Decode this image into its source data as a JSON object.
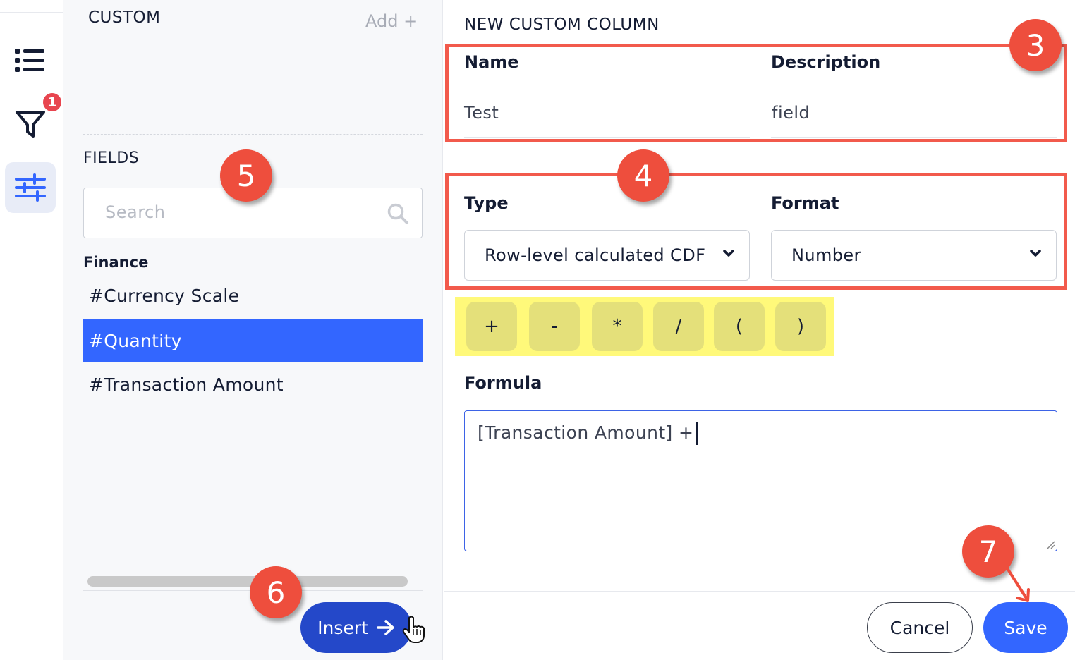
{
  "rail": {
    "items": [
      {
        "name": "list-icon"
      },
      {
        "name": "filter-icon",
        "badge": "1"
      },
      {
        "name": "sliders-icon",
        "active": true
      }
    ]
  },
  "custom": {
    "title": "CUSTOM",
    "add_label": "Add +"
  },
  "fields": {
    "title": "FIELDS",
    "search_placeholder": "Search",
    "group_title": "Finance",
    "items": [
      {
        "label": "#Currency Scale",
        "selected": false
      },
      {
        "label": "#Quantity",
        "selected": true
      },
      {
        "label": "#Transaction Amount",
        "selected": false
      }
    ],
    "insert_label": "Insert"
  },
  "form": {
    "title": "NEW CUSTOM COLUMN",
    "name_label": "Name",
    "name_value": "Test",
    "description_label": "Description",
    "description_value": "field",
    "type_label": "Type",
    "type_value": "Row-level calculated CDF",
    "format_label": "Format",
    "format_value": "Number",
    "operators": [
      "+",
      "-",
      "*",
      "/",
      "(",
      ")"
    ],
    "formula_label": "Formula",
    "formula_value": "[Transaction Amount] +",
    "cancel_label": "Cancel",
    "save_label": "Save"
  },
  "callouts": [
    "3",
    "4",
    "5",
    "6",
    "7"
  ],
  "colors": {
    "accent": "#3366ff",
    "insert": "#2448c9",
    "annotation": "#ee4e3d",
    "operator_highlight": "#fff97a",
    "badge": "#e8454f"
  }
}
